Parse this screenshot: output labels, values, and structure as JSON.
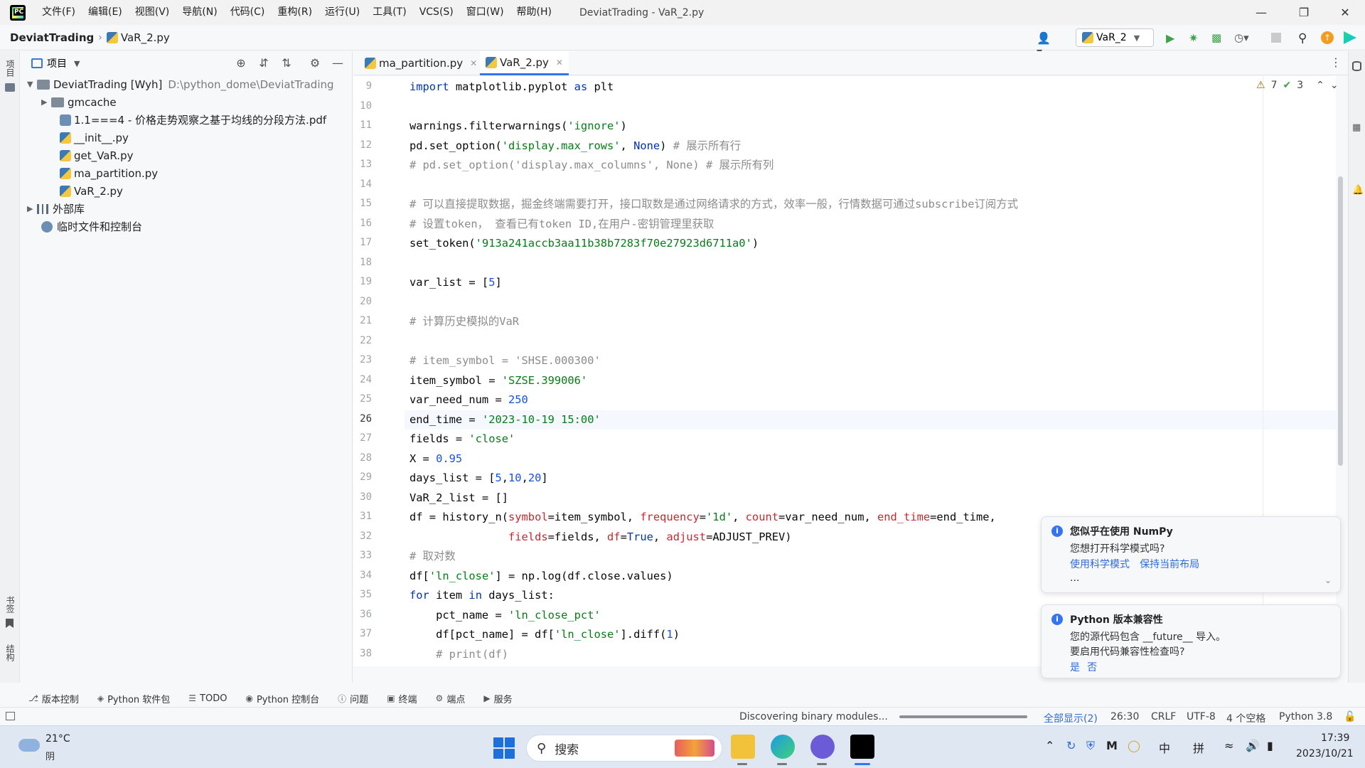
{
  "titlebar": {
    "menus": [
      "文件(F)",
      "编辑(E)",
      "视图(V)",
      "导航(N)",
      "代码(C)",
      "重构(R)",
      "运行(U)",
      "工具(T)",
      "VCS(S)",
      "窗口(W)",
      "帮助(H)"
    ],
    "window_title": "DeviatTrading - VaR_2.py"
  },
  "navbar": {
    "project": "DeviatTrading",
    "file": "VaR_2.py",
    "run_config": "VaR_2"
  },
  "project_panel": {
    "header": "项目",
    "tree": [
      {
        "label": "DeviatTrading [Wyh]",
        "path": "D:\\python_dome\\DeviatTrading",
        "kind": "root"
      },
      {
        "label": "gmcache",
        "kind": "folder"
      },
      {
        "label": "1.1===4 - 价格走势观察之基于均线的分段方法.pdf",
        "kind": "file"
      },
      {
        "label": "__init__.py",
        "kind": "file"
      },
      {
        "label": "get_VaR.py",
        "kind": "file"
      },
      {
        "label": "ma_partition.py",
        "kind": "file"
      },
      {
        "label": "VaR_2.py",
        "kind": "file"
      },
      {
        "label": "外部库",
        "kind": "lib"
      },
      {
        "label": "临时文件和控制台",
        "kind": "scratch"
      }
    ]
  },
  "left_stripe": {
    "top_label": "项目",
    "bookmarks_label": "书签",
    "structure_label": "结构"
  },
  "editor": {
    "tabs": [
      {
        "label": "ma_partition.py",
        "active": false
      },
      {
        "label": "VaR_2.py",
        "active": true
      }
    ],
    "warnings": "7",
    "checks": "3",
    "current_line": 26,
    "lines": [
      {
        "n": "9",
        "html": "<span class='kw'>import</span> matplotlib.pyplot <span class='kw'>as</span> plt"
      },
      {
        "n": "10",
        "html": ""
      },
      {
        "n": "11",
        "html": "warnings.filterwarnings(<span class='str'>'ignore'</span>)"
      },
      {
        "n": "12",
        "html": "pd.set_option(<span class='str'>'display.max_rows'</span>, <span class='kw'>None</span>) <span class='cmt'># 展示所有行</span>"
      },
      {
        "n": "13",
        "html": "<span class='cmt'># pd.set_option('display.max_columns', None) # 展示所有列</span>"
      },
      {
        "n": "14",
        "html": ""
      },
      {
        "n": "15",
        "html": "<span class='cmt'># 可以直接提取数据，掘金终端需要打开，接口取数是通过网络请求的方式，效率一般，行情数据可通过subscribe订阅方式</span>"
      },
      {
        "n": "16",
        "html": "<span class='cmt'># 设置token， 查看已有token ID,在用户-密钥管理里获取</span>"
      },
      {
        "n": "17",
        "html": "set_token(<span class='str'>'913a241accb3aa11b38b7283f70e27923d6711a0'</span>)"
      },
      {
        "n": "18",
        "html": ""
      },
      {
        "n": "19",
        "html": "var_list = [<span class='num'>5</span>]"
      },
      {
        "n": "20",
        "html": ""
      },
      {
        "n": "21",
        "html": "<span class='cmt'># 计算历史模拟的VaR</span>"
      },
      {
        "n": "22",
        "html": ""
      },
      {
        "n": "23",
        "html": "<span class='cmt'># item_symbol = 'SHSE.000300'</span>"
      },
      {
        "n": "24",
        "html": "item_symbol = <span class='str'>'SZSE.399006'</span>"
      },
      {
        "n": "25",
        "html": "var_need_num = <span class='num'>250</span>"
      },
      {
        "n": "26",
        "html": "end_time = <span class='str'>'2023-10-19 15:00'</span>"
      },
      {
        "n": "27",
        "html": "fields = <span class='str'>'close'</span>"
      },
      {
        "n": "28",
        "html": "X = <span class='num'>0.95</span>"
      },
      {
        "n": "29",
        "html": "days_list = [<span class='num'>5</span>,<span class='num'>10</span>,<span class='num'>20</span>]"
      },
      {
        "n": "30",
        "html": "VaR_2_list = []"
      },
      {
        "n": "31",
        "html": "df = history_n(<span class='param'>symbol</span>=item_symbol, <span class='param'>frequency</span>=<span class='str'>'1d'</span>, <span class='param'>count</span>=var_need_num, <span class='param'>end_time</span>=end_time,"
      },
      {
        "n": "32",
        "html": "               <span class='param'>fields</span>=fields, <span class='param'>df</span>=<span class='kw'>True</span>, <span class='param'>adjust</span>=ADJUST_PREV)"
      },
      {
        "n": "33",
        "html": "<span class='cmt'># 取对数</span>"
      },
      {
        "n": "34",
        "html": "df[<span class='str'>'ln_close'</span>] = np.log(df.close.values)"
      },
      {
        "n": "35",
        "html": "<span class='kw'>for</span> item <span class='kw'>in</span> days_list:"
      },
      {
        "n": "36",
        "html": "    pct_name = <span class='str'>'ln_close_pct'</span>"
      },
      {
        "n": "37",
        "html": "    df[pct_name] = df[<span class='str'>'ln_close'</span>].diff(<span class='num'>1</span>)"
      },
      {
        "n": "38",
        "html": "    <span class='cmt'># print(df)</span>"
      }
    ]
  },
  "notifications": [
    {
      "title": "您似乎在使用 NumPy",
      "body": "您想打开科学模式吗?",
      "links": [
        "使用科学模式",
        "保持当前布局"
      ],
      "more": "..."
    },
    {
      "title": "Python 版本兼容性",
      "body1": "您的源代码包含 __future__ 导入。",
      "body2": "要启用代码兼容性检查吗?",
      "links": [
        "是",
        "否"
      ]
    }
  ],
  "tool_windows": [
    "版本控制",
    "Python 软件包",
    "TODO",
    "Python 控制台",
    "问题",
    "终端",
    "端点",
    "服务"
  ],
  "status": {
    "progress_text": "Discovering binary modules...",
    "show_all": "全部显示(2)",
    "position": "26:30",
    "line_ending": "CRLF",
    "encoding": "UTF-8",
    "indent": "4 个空格",
    "interpreter": "Python 3.8"
  },
  "taskbar": {
    "temp": "21°C",
    "weather": "阴",
    "search": "搜索",
    "ime1": "中",
    "ime2": "拼",
    "time": "17:39",
    "date": "2023/10/21"
  },
  "colors": {
    "accent": "#3574f0",
    "keyword": "#0033b3",
    "string": "#067d17",
    "number": "#1750eb",
    "comment": "#8c8c8c",
    "param": "#c9272d"
  }
}
